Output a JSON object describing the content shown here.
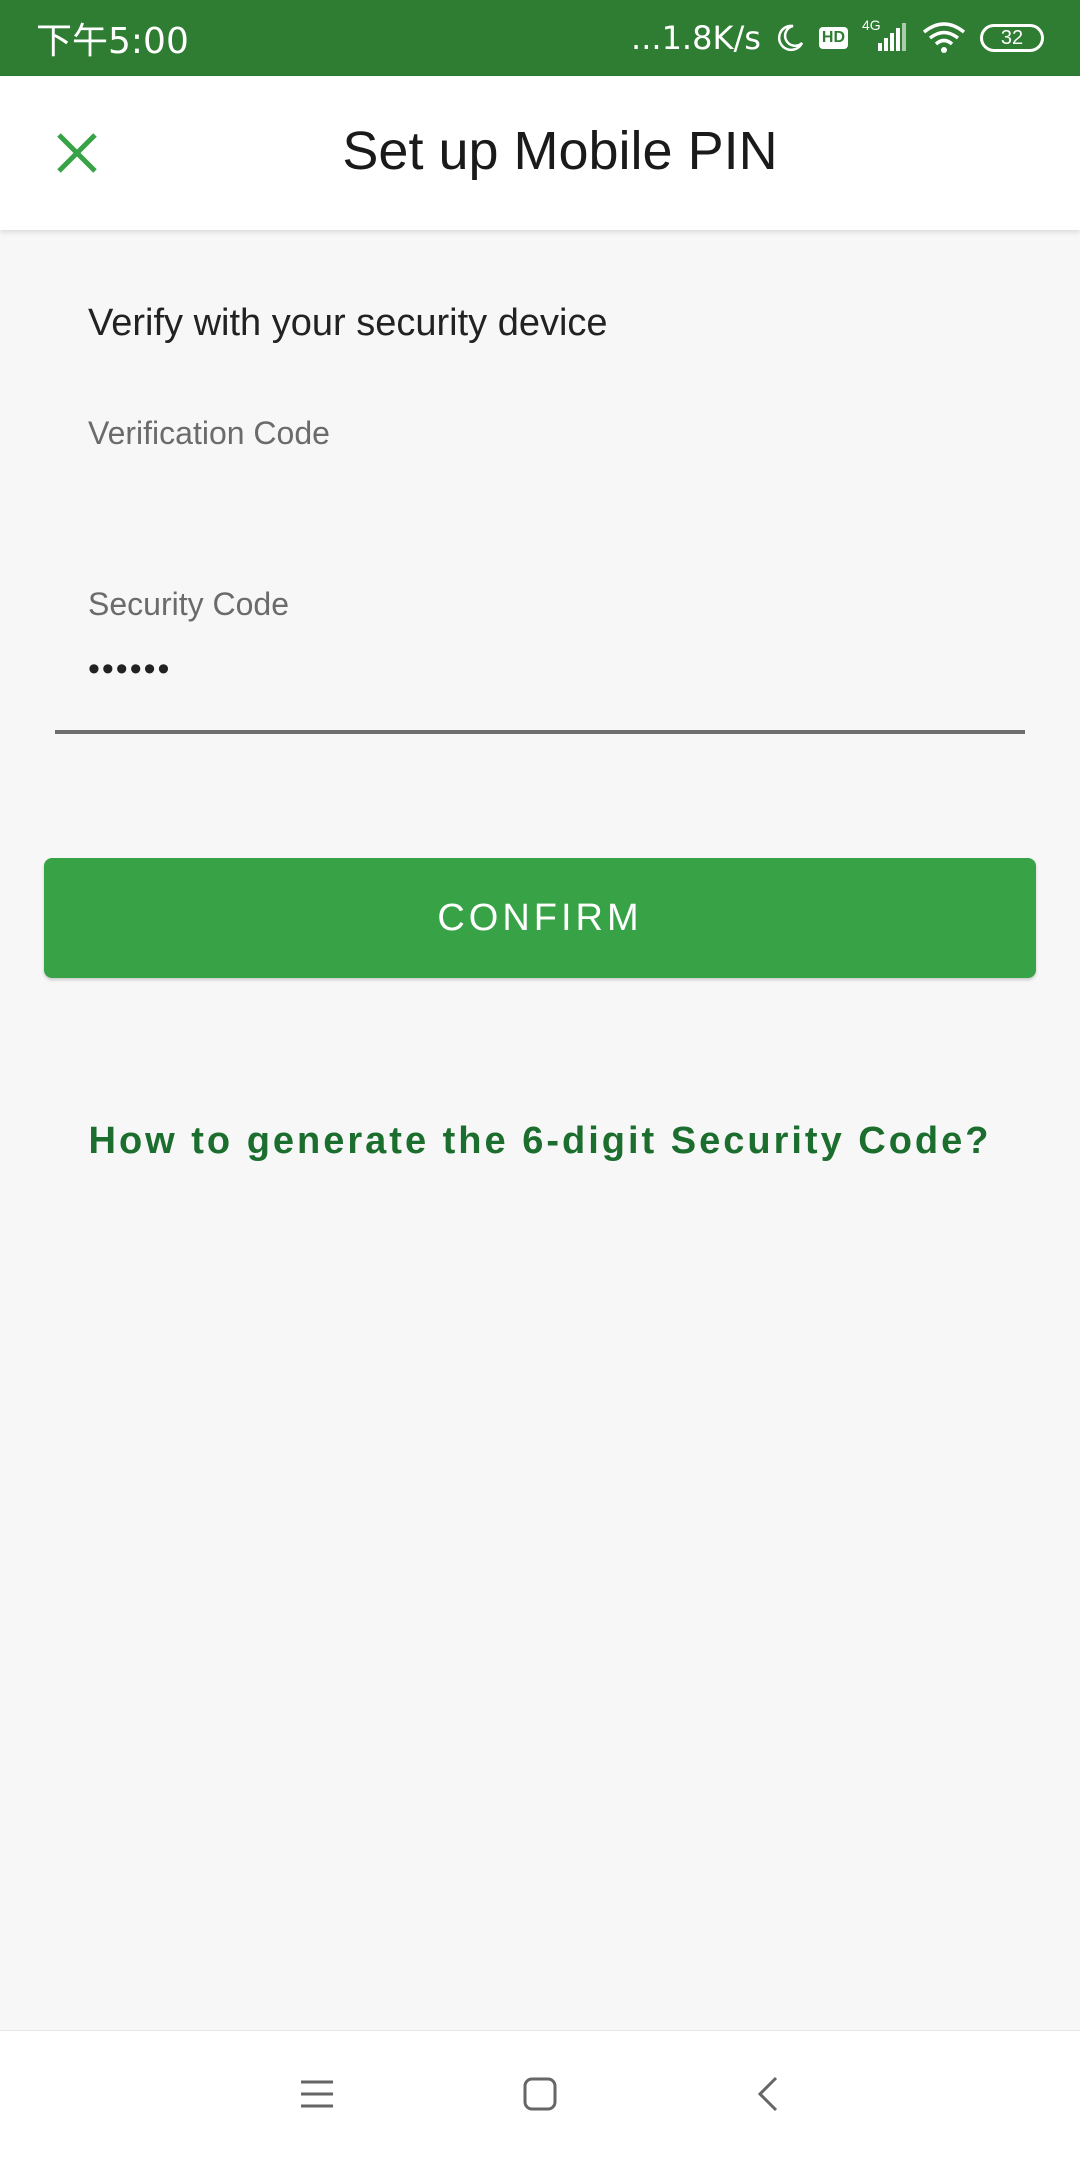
{
  "status_bar": {
    "time": "下午5:00",
    "network_speed": "...1.8K/s",
    "hd_label": "HD",
    "signal_label": "4G",
    "battery_level": "32",
    "icons": [
      "moon-icon",
      "hd-icon",
      "signal-icon",
      "wifi-icon",
      "battery-icon"
    ]
  },
  "app_bar": {
    "title": "Set up Mobile PIN",
    "close_icon": "close-icon"
  },
  "form": {
    "heading": "Verify with your security device",
    "verification_label": "Verification Code",
    "verification_value": "",
    "security_label": "Security Code",
    "security_value": "••••••"
  },
  "actions": {
    "confirm_label": "CONFIRM",
    "help_link": "How to generate the 6-digit Security Code?"
  },
  "nav_bar": {
    "icons": [
      "menu-icon",
      "home-icon",
      "back-icon"
    ]
  },
  "colors": {
    "status_bar": "#2e7d32",
    "accent": "#37a346",
    "link": "#1b6e2e",
    "background": "#f7f7f7"
  }
}
